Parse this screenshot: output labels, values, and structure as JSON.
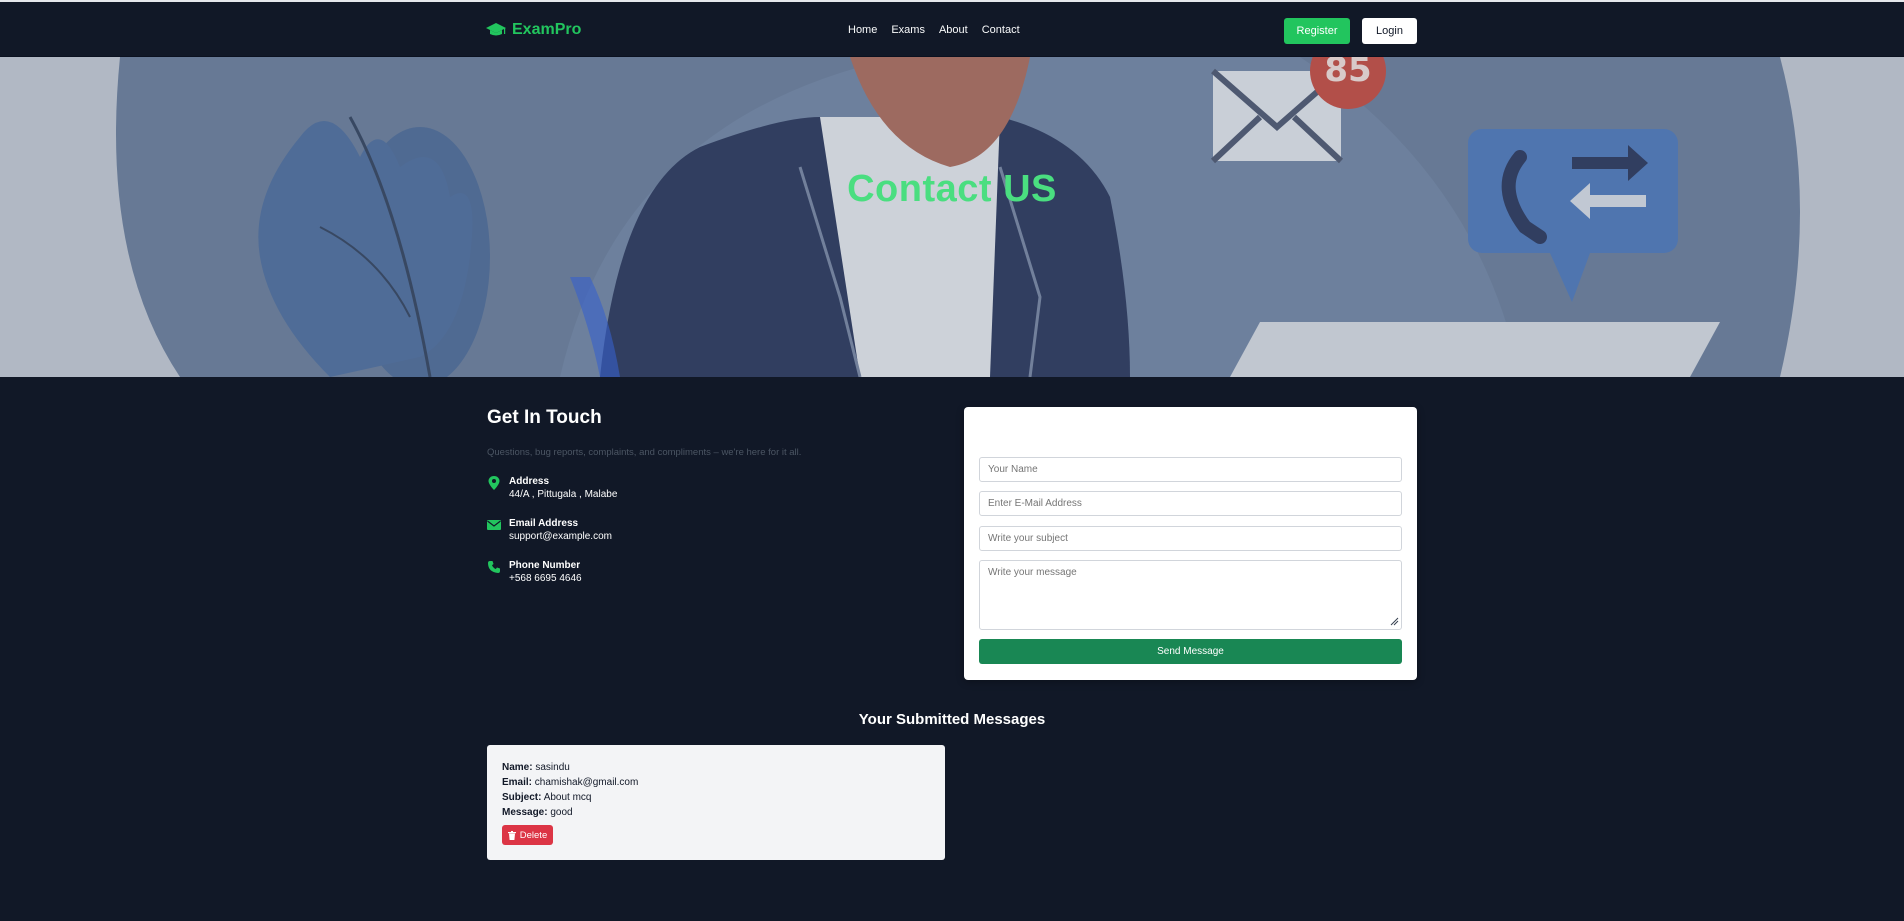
{
  "nav": {
    "brand": "ExamPro",
    "links": [
      "Home",
      "Exams",
      "About",
      "Contact"
    ],
    "register": "Register",
    "login": "Login"
  },
  "hero": {
    "title": "Contact US",
    "badge": "85"
  },
  "contact": {
    "title": "Get In Touch",
    "subtitle": "Questions, bug reports, complaints, and compliments – we're here for it all.",
    "address_label": "Address",
    "address_value": "44/A , Pittugala , Malabe",
    "email_label": "Email Address",
    "email_value": "support@example.com",
    "phone_label": "Phone Number",
    "phone_value": "+568 6695 4646"
  },
  "form": {
    "name_placeholder": "Your Name",
    "email_placeholder": "Enter E-Mail Address",
    "subject_placeholder": "Write your subject",
    "message_placeholder": "Write your message",
    "send": "Send Message"
  },
  "submitted": {
    "title": "Your Submitted Messages",
    "name_label": "Name:",
    "name": "sasindu",
    "email_label": "Email:",
    "email": "chamishak@gmail.com",
    "subject_label": "Subject:",
    "subject": "About mcq",
    "message_label": "Message:",
    "message": "good",
    "delete": "Delete"
  },
  "colors": {
    "accent": "#22c55e",
    "background": "#111827",
    "send_button": "#198754",
    "delete_button": "#dc3545"
  }
}
